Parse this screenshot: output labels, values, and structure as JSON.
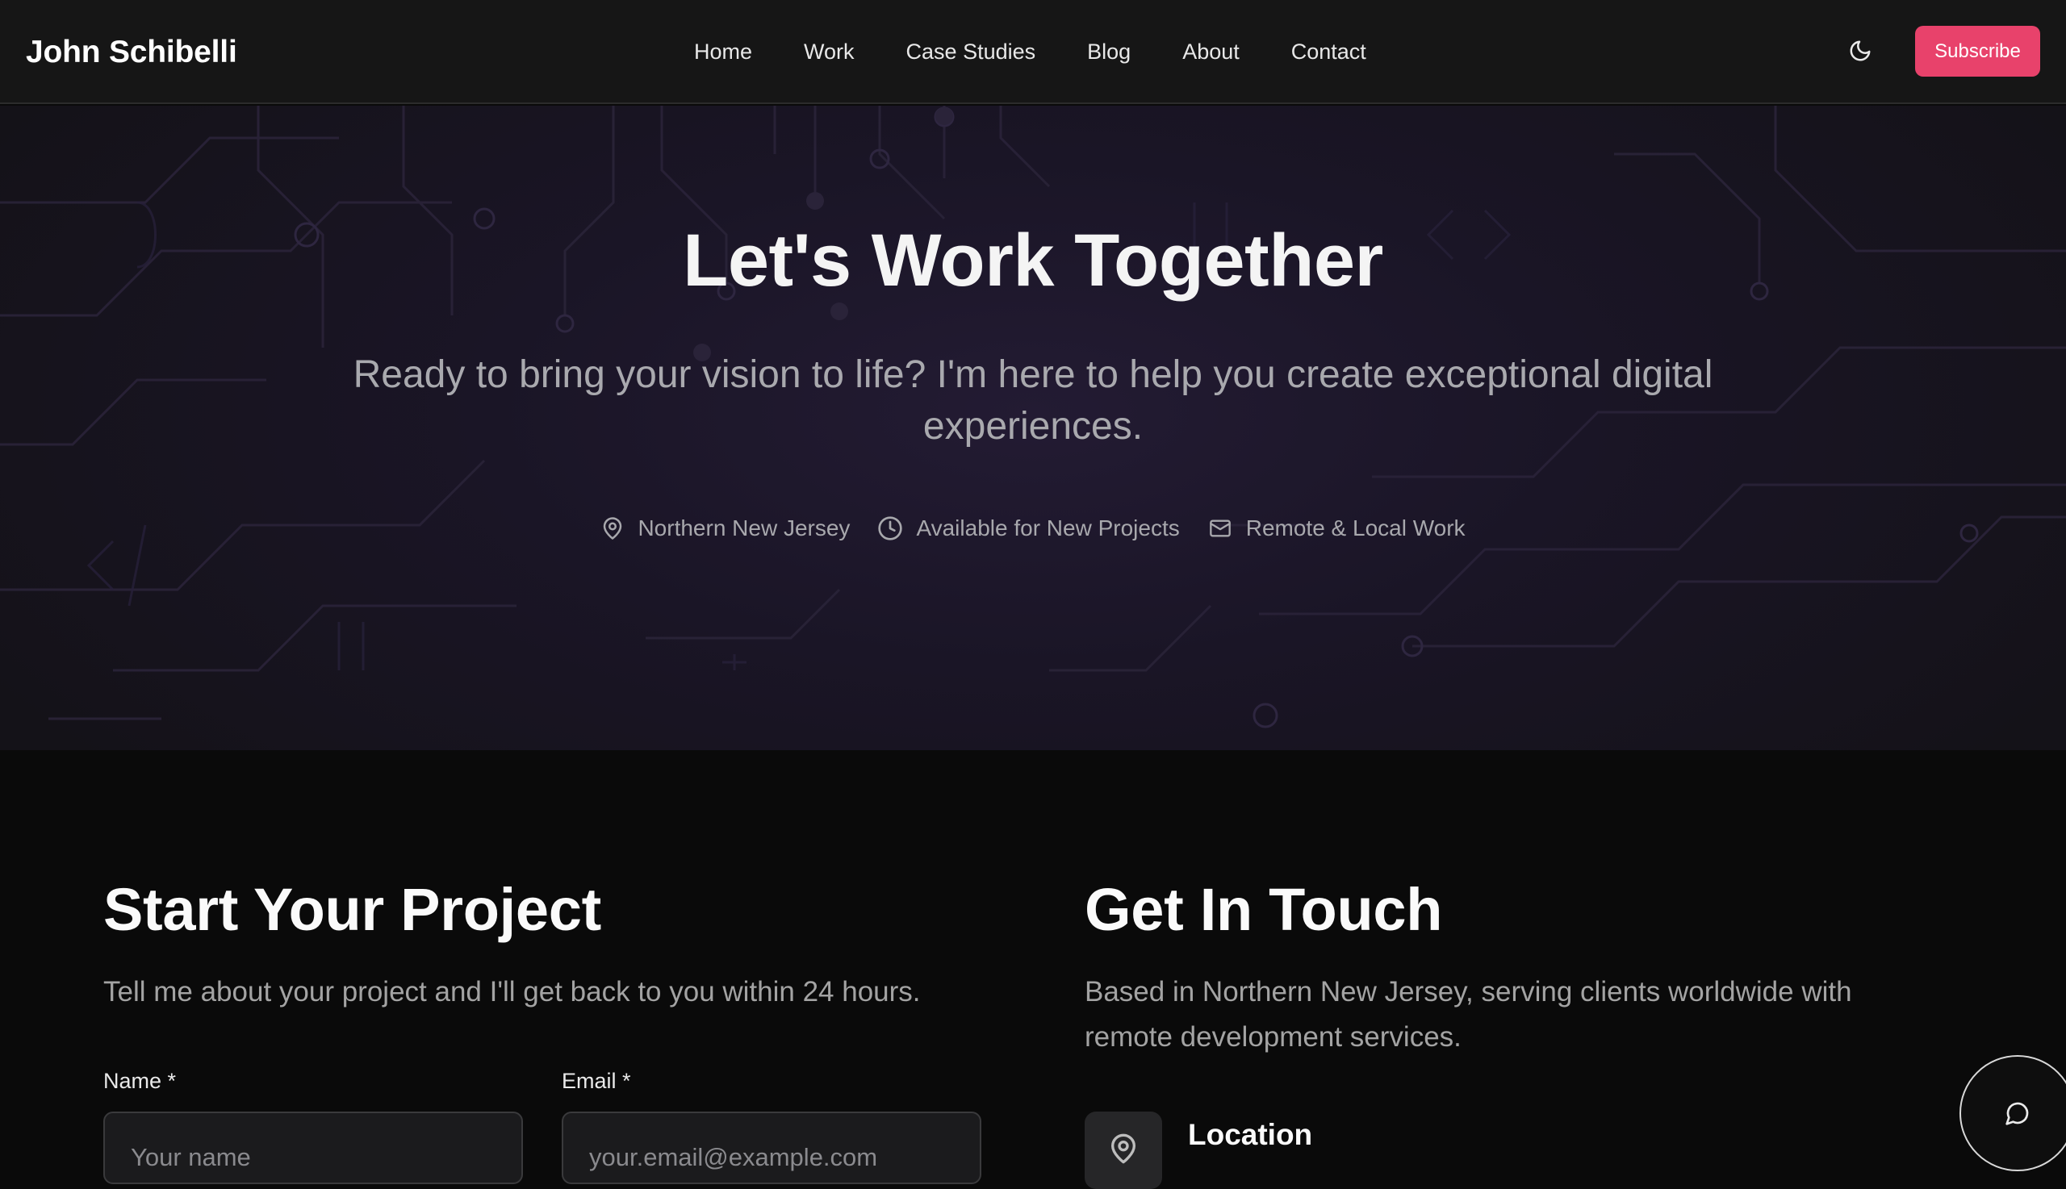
{
  "header": {
    "brand": "John Schibelli",
    "nav": [
      "Home",
      "Work",
      "Case Studies",
      "Blog",
      "About",
      "Contact"
    ],
    "theme_toggle_icon": "moon-icon",
    "subscribe_label": "Subscribe"
  },
  "hero": {
    "title": "Let's Work Together",
    "subtitle": "Ready to bring your vision to life? I'm here to help you create exceptional digital experiences.",
    "meta": [
      {
        "icon": "map-pin-icon",
        "text": "Northern New Jersey"
      },
      {
        "icon": "clock-icon",
        "text": "Available for New Projects"
      },
      {
        "icon": "mail-icon",
        "text": "Remote & Local Work"
      }
    ]
  },
  "project": {
    "title": "Start Your Project",
    "description": "Tell me about your project and I'll get back to you within 24 hours.",
    "name_label": "Name *",
    "name_placeholder": "Your name",
    "email_label": "Email *",
    "email_placeholder": "your.email@example.com"
  },
  "touch": {
    "title": "Get In Touch",
    "description": "Based in Northern New Jersey, serving clients worldwide with remote development services.",
    "location_title": "Location",
    "location_icon": "map-pin-icon"
  },
  "chat": {
    "icon": "chat-bubble-icon"
  },
  "colors": {
    "accent": "#e8426b",
    "header_bg": "#161616",
    "page_bg": "#0a0a0a",
    "hero_bg": "#1c1728"
  }
}
